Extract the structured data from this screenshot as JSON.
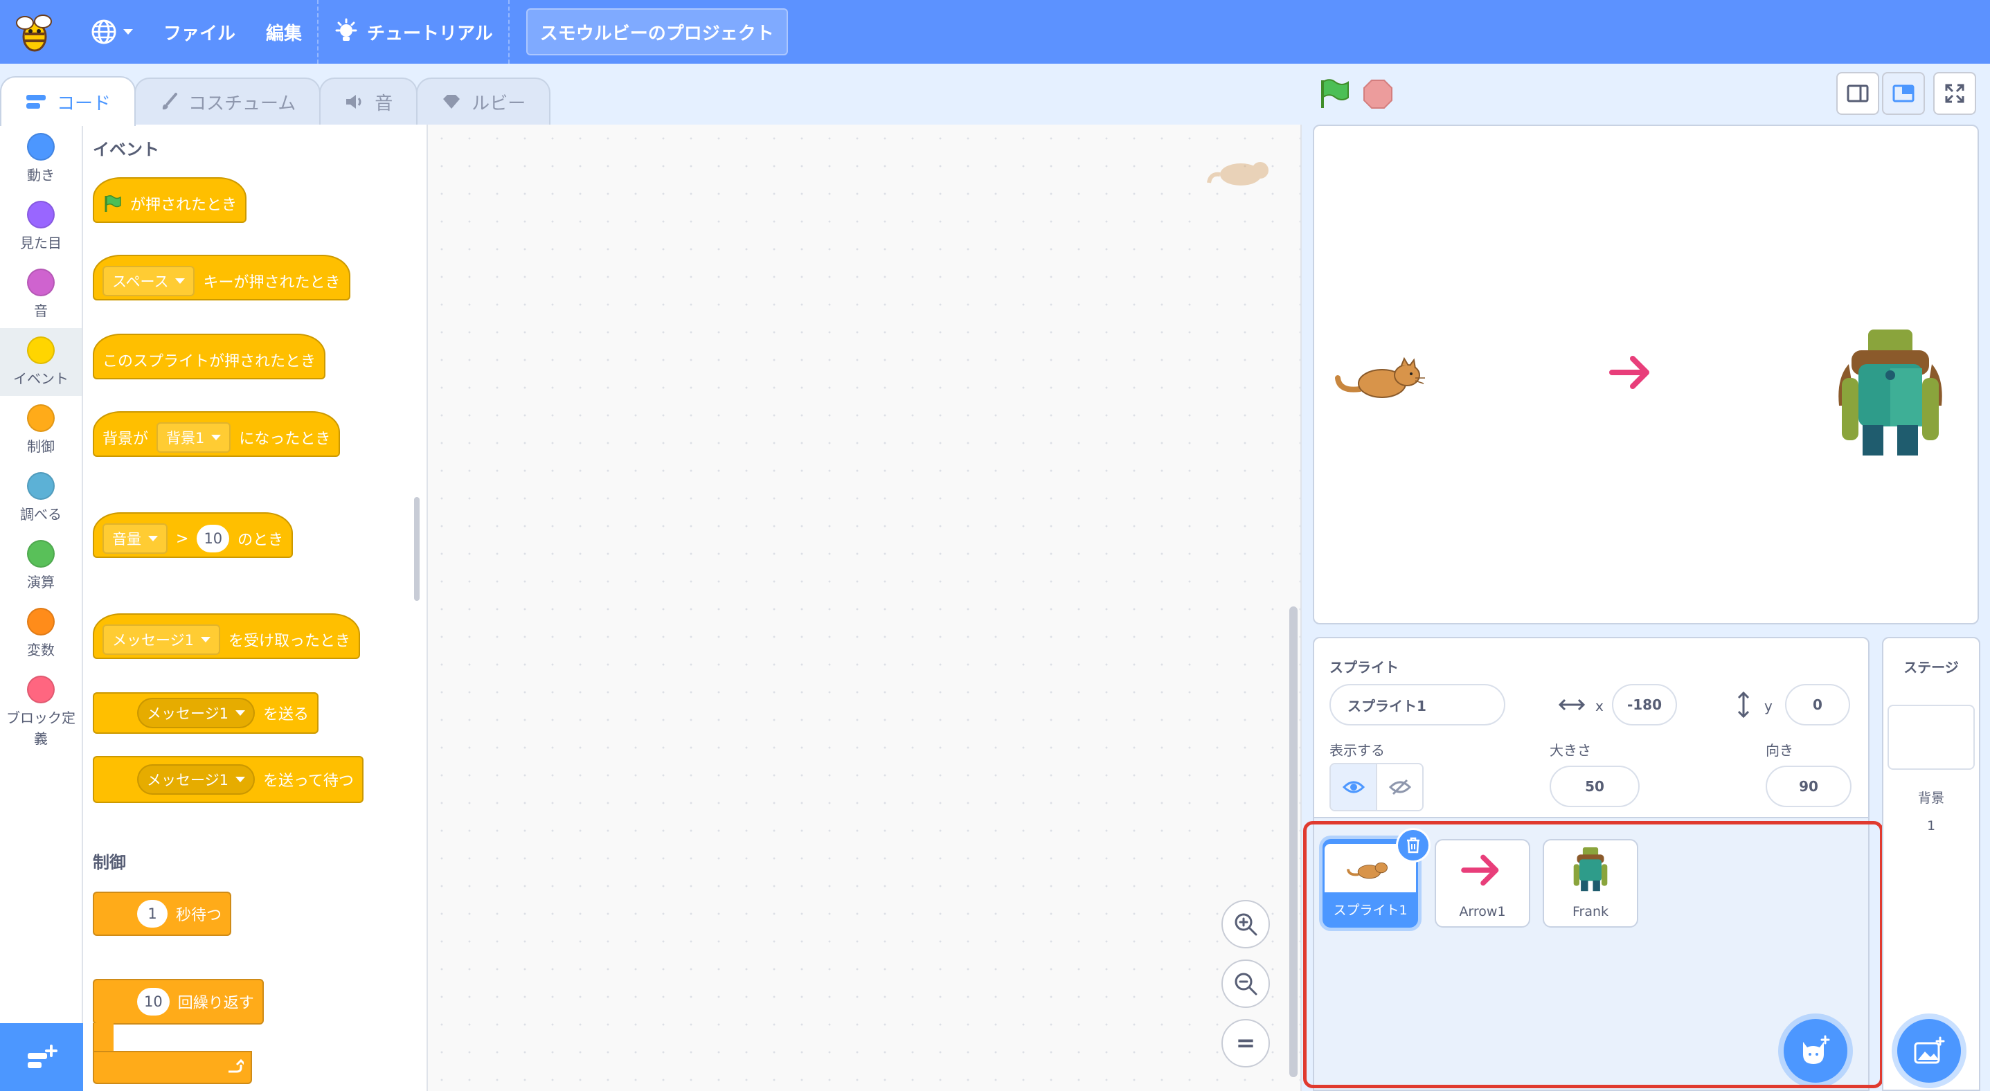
{
  "menubar": {
    "file": "ファイル",
    "edit": "編集",
    "tutorial": "チュートリアル",
    "project_title": "スモウルビーのプロジェクト",
    "icons": [
      "bee-logo",
      "globe-icon",
      "chevron-down-icon",
      "lightbulb-icon"
    ]
  },
  "tabs": [
    {
      "label": "コード",
      "icon": "code-icon",
      "active": true
    },
    {
      "label": "コスチューム",
      "icon": "brush-icon",
      "active": false
    },
    {
      "label": "音",
      "icon": "speaker-icon",
      "active": false
    },
    {
      "label": "ルビー",
      "icon": "ruby-icon",
      "active": false
    }
  ],
  "categories": [
    {
      "label": "動き",
      "color": "#4c97ff"
    },
    {
      "label": "見た目",
      "color": "#9966ff"
    },
    {
      "label": "音",
      "color": "#cf63cf"
    },
    {
      "label": "イベント",
      "color": "#ffd500",
      "selected": true
    },
    {
      "label": "制御",
      "color": "#ffab19"
    },
    {
      "label": "調べる",
      "color": "#5cb1d6"
    },
    {
      "label": "演算",
      "color": "#59c059"
    },
    {
      "label": "変数",
      "color": "#ff8c1a"
    },
    {
      "label": "ブロック定義",
      "color": "#ff6680"
    }
  ],
  "palette": {
    "events_heading": "イベント",
    "control_heading": "制御",
    "blocks": {
      "flag_clicked": "が押されたとき",
      "key_dropdown": "スペース",
      "key_pressed": "キーが押されたとき",
      "sprite_clicked": "このスプライトが押されたとき",
      "backdrop_prefix": "背景が",
      "backdrop_dropdown": "背景1",
      "backdrop_suffix": "になったとき",
      "loudness_dropdown": "音量",
      "gt": ">",
      "loudness_value": "10",
      "loudness_suffix": "のとき",
      "msg_dropdown": "メッセージ1",
      "msg_received": "を受け取ったとき",
      "broadcast_dropdown": "メッセージ1",
      "broadcast": "を送る",
      "broadcast_wait_dropdown": "メッセージ1",
      "broadcast_wait": "を送って待つ",
      "wait_value": "1",
      "wait": "秒待つ",
      "repeat_value": "10",
      "repeat": "回繰り返す"
    }
  },
  "workspace": {
    "zoom_reset_label": "="
  },
  "sprite_info": {
    "sprite_label": "スプライト",
    "sprite_name": "スプライト1",
    "x_label": "x",
    "x_value": "-180",
    "y_label": "y",
    "y_value": "0",
    "show_label": "表示する",
    "size_label": "大きさ",
    "size_value": "50",
    "direction_label": "向き",
    "direction_value": "90"
  },
  "sprites": [
    {
      "name": "スプライト1",
      "icon": "cat-sprite",
      "selected": true
    },
    {
      "name": "Arrow1",
      "icon": "arrow-sprite",
      "selected": false
    },
    {
      "name": "Frank",
      "icon": "frank-sprite",
      "selected": false
    }
  ],
  "stage_panel": {
    "title": "ステージ",
    "backdrop_label": "背景",
    "backdrop_count": "1"
  },
  "colors": {
    "menubar": "#5c92ff",
    "accent": "#4c97ff",
    "events_block": "#ffbf00",
    "control_block": "#ffab19",
    "highlight": "#e03a2f"
  }
}
